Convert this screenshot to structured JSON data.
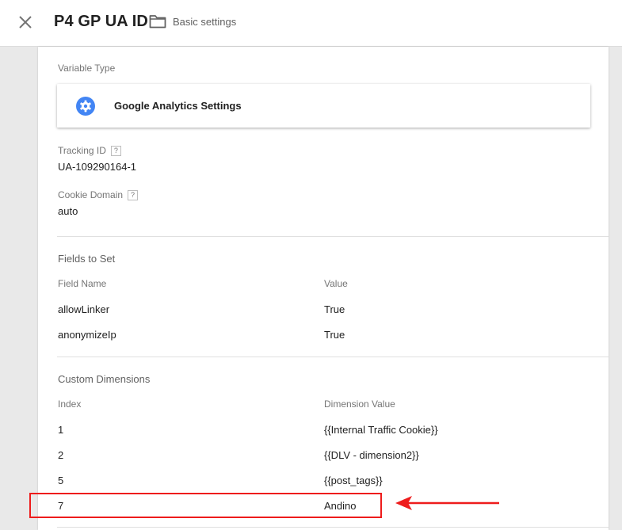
{
  "header": {
    "title": "P4 GP UA ID",
    "folder_name": "Basic settings"
  },
  "variable_type": {
    "label": "Variable Type",
    "name": "Google Analytics Settings"
  },
  "tracking_id": {
    "label": "Tracking ID",
    "help": "?",
    "value": "UA-109290164-1"
  },
  "cookie_domain": {
    "label": "Cookie Domain",
    "help": "?",
    "value": "auto"
  },
  "fields_to_set": {
    "title": "Fields to Set",
    "col_name": "Field Name",
    "col_value": "Value",
    "rows": [
      {
        "name": "allowLinker",
        "value": "True"
      },
      {
        "name": "anonymizeIp",
        "value": "True"
      }
    ]
  },
  "custom_dimensions": {
    "title": "Custom Dimensions",
    "col_index": "Index",
    "col_value": "Dimension Value",
    "rows": [
      {
        "index": "1",
        "value": "{{Internal Traffic Cookie}}"
      },
      {
        "index": "2",
        "value": "{{DLV - dimension2}}"
      },
      {
        "index": "5",
        "value": "{{post_tags}}"
      },
      {
        "index": "7",
        "value": "Andino"
      }
    ]
  },
  "icons": {
    "close": "close-icon",
    "folder": "folder-icon",
    "gear": "gear-icon",
    "help": "help-icon"
  },
  "colors": {
    "gear_blue": "#4285f4",
    "annotation_red": "#ee1c1c"
  }
}
